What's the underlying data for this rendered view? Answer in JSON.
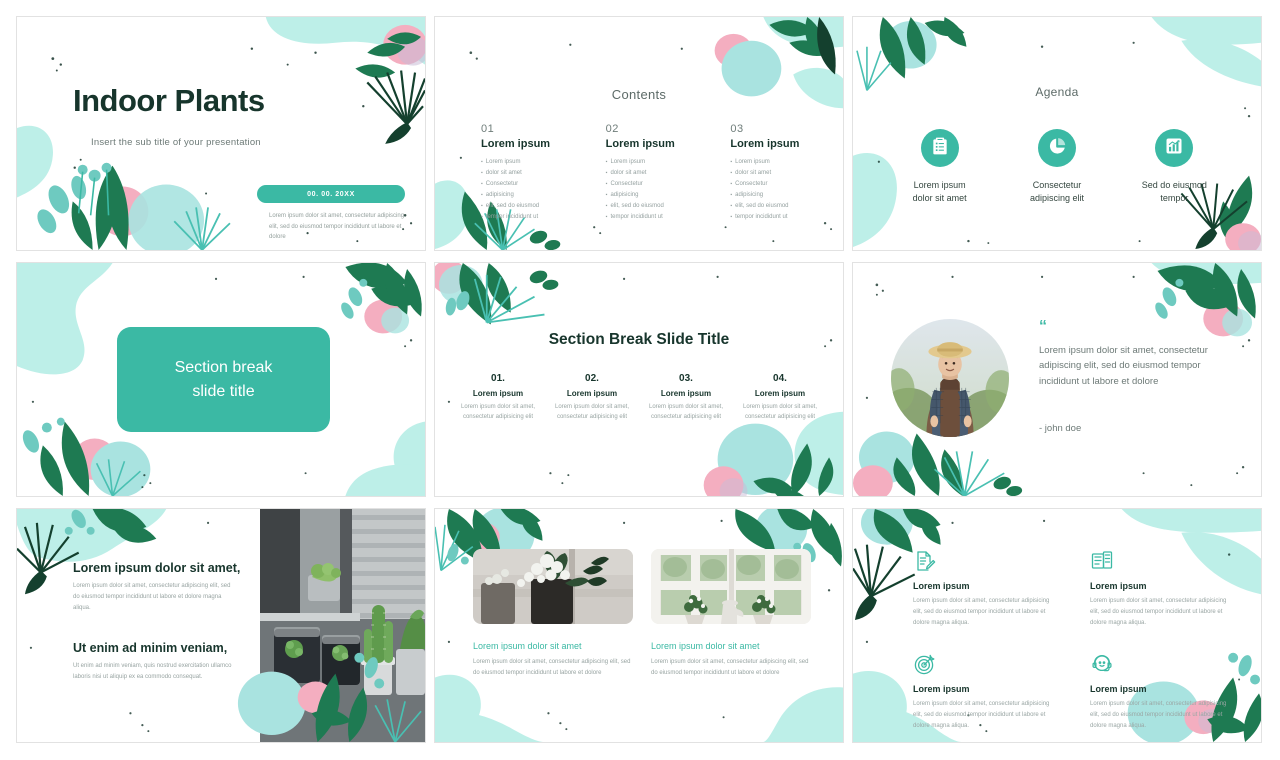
{
  "theme": {
    "teal": "#3bb9a4",
    "mint": "#bdefe8",
    "mint_pale": "#d7f4f0",
    "dark_green": "#1e7a52",
    "deep_green": "#17352c",
    "pink": "#f4aec0",
    "gray_text": "#98a4a2",
    "slide_border": "#e2e2e2",
    "page_background": "#ffffff"
  },
  "slides": [
    {
      "name": "title-slide",
      "title": "Indoor Plants",
      "subtitle": "Insert the sub title of your presentation",
      "date_badge": "00. 00. 20XX",
      "body": "Lorem ipsum dolor sit amet, consectetur adipiscing elit, sed do eiusmod tempor incididunt ut labore et dolore"
    },
    {
      "name": "contents-slide",
      "heading": "Contents",
      "columns": [
        {
          "number": "01",
          "title": "Lorem ipsum",
          "bullets": [
            "Lorem ipsum",
            "dolor sit amet",
            "Consectetur",
            "adipisicing",
            "elit, sed do eiusmod",
            "tempor incididunt ut"
          ]
        },
        {
          "number": "02",
          "title": "Lorem ipsum",
          "bullets": [
            "Lorem ipsum",
            "dolor sit amet",
            "Consectetur",
            "adipisicing",
            "elit, sed do eiusmod",
            "tempor incididunt ut"
          ]
        },
        {
          "number": "03",
          "title": "Lorem ipsum",
          "bullets": [
            "Lorem ipsum",
            "dolor sit amet",
            "Consectetur",
            "adipisicing",
            "elit, sed do eiusmod",
            "tempor incididunt ut"
          ]
        }
      ]
    },
    {
      "name": "agenda-slide",
      "heading": "Agenda",
      "items": [
        {
          "icon": "clipboard-checklist-icon",
          "label": "Lorem ipsum\ndolor sit amet"
        },
        {
          "icon": "pie-chart-icon",
          "label": "Consectetur\nadipiscing elit"
        },
        {
          "icon": "bar-chart-trend-icon",
          "label": "Sed do eiusmod\ntempor"
        }
      ]
    },
    {
      "name": "section-break-box-slide",
      "box_text": "Section break\nslide title"
    },
    {
      "name": "section-break-four-slide",
      "heading": "Section Break Slide Title",
      "items": [
        {
          "number": "01.",
          "title": "Lorem ipsum",
          "body": "Lorem ipsum dolor sit amet, consectetur adipisicing elit"
        },
        {
          "number": "02.",
          "title": "Lorem ipsum",
          "body": "Lorem ipsum dolor sit amet, consectetur adipisicing elit"
        },
        {
          "number": "03.",
          "title": "Lorem ipsum",
          "body": "Lorem ipsum dolor sit amet, consectetur adipisicing elit"
        },
        {
          "number": "04.",
          "title": "Lorem ipsum",
          "body": "Lorem ipsum dolor sit amet, consectetur adipisicing elit"
        }
      ]
    },
    {
      "name": "quote-slide",
      "quote_mark": "“",
      "quote": "Lorem ipsum dolor sit amet, consectetur adipiscing elit, sed do eiusmod tempor incididunt ut labore et dolore",
      "author": "- john doe",
      "photo_alt": "elderly-gardener-in-straw-hat-portrait"
    },
    {
      "name": "text-and-image-slide",
      "heading_1": "Lorem ipsum dolor sit amet,",
      "body_1": "Lorem ipsum dolor sit amet, consectetur adipiscing elit, sed do eiusmod tempor incididunt ut labore et dolore magna aliqua.",
      "heading_2": "Ut enim ad minim veniam,",
      "body_2": "Ut enim ad minim veniam, quis nostrud exercitation ullamco laboris nisi ut aliquip ex ea commodo consequat.",
      "photo_alt": "cacti-and-succulents-by-window-blinds"
    },
    {
      "name": "two-cards-slide",
      "cards": [
        {
          "title": "Lorem ipsum dolor sit amet",
          "body": "Lorem ipsum dolor sit amet, consectetur adipiscing elit, sed do eiusmod tempor incididunt ut labore et dolore",
          "photo_alt": "white-flowers-in-dark-pot"
        },
        {
          "title": "Lorem ipsum dolor sit amet",
          "body": "Lorem ipsum dolor sit amet, consectetur adipiscing elit, sed do eiusmod tempor incididunt ut labore et dolore",
          "photo_alt": "potted-plants-on-window-sill"
        }
      ]
    },
    {
      "name": "four-features-slide",
      "features": [
        {
          "icon": "document-edit-icon",
          "title": "Lorem ipsum",
          "body": "Lorem ipsum dolor sit amet, consectetur adipisicing elit, sed do eiusmod tempor incididunt ut labore et dolore magna aliqua."
        },
        {
          "icon": "newspaper-layout-icon",
          "title": "Lorem ipsum",
          "body": "Lorem ipsum dolor sit amet, consectetur adipisicing elit, sed do eiusmod tempor incididunt ut labore et dolore magna aliqua."
        },
        {
          "icon": "target-dart-icon",
          "title": "Lorem ipsum",
          "body": "Lorem ipsum dolor sit amet, consectetur adipisicing elit, sed do eiusmod tempor incididunt ut labore et dolore magna aliqua."
        },
        {
          "icon": "headset-support-icon",
          "title": "Lorem ipsum",
          "body": "Lorem ipsum dolor sit amet, consectetur adipisicing elit, sed do eiusmod tempor incididunt ut labore et dolore magna aliqua."
        }
      ]
    }
  ]
}
